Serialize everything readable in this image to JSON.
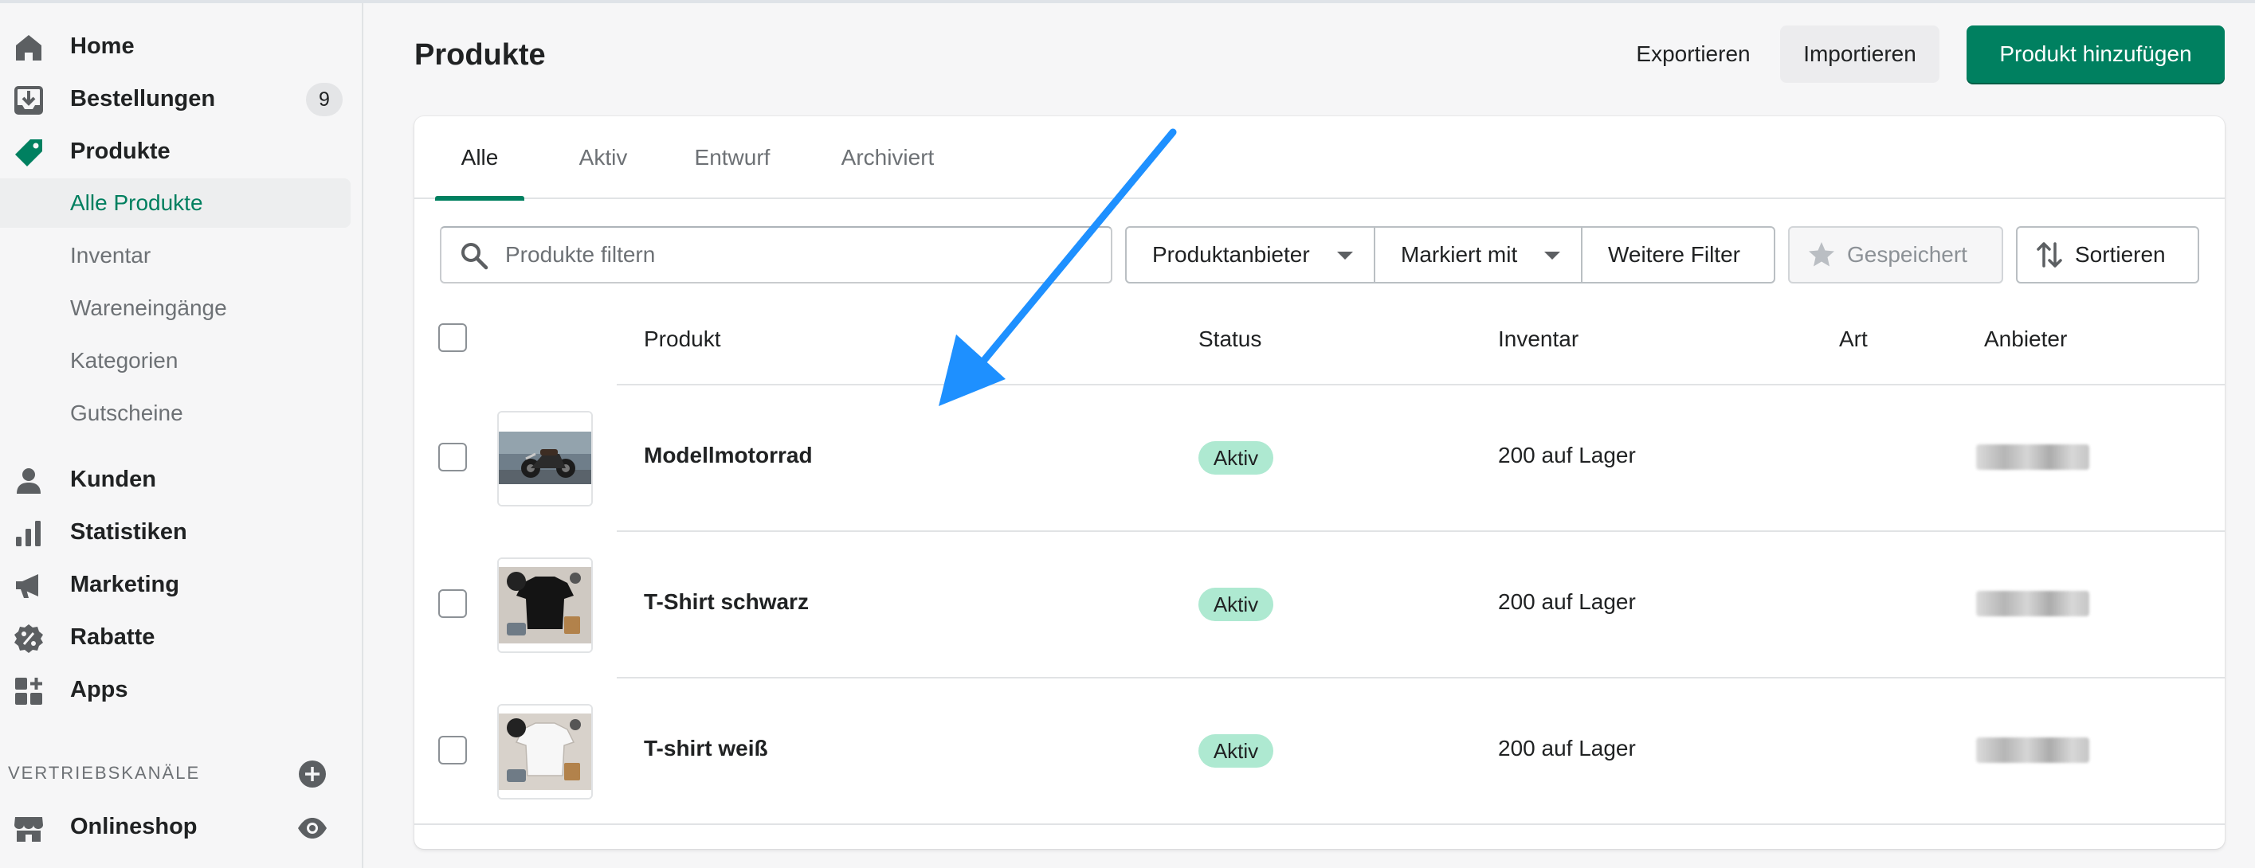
{
  "sidebar": {
    "items": [
      {
        "label": "Home",
        "icon": "home-icon"
      },
      {
        "label": "Bestellungen",
        "icon": "orders-icon",
        "badge": "9"
      },
      {
        "label": "Produkte",
        "icon": "tag-icon"
      },
      {
        "label": "Kunden",
        "icon": "person-icon"
      },
      {
        "label": "Statistiken",
        "icon": "bar-chart-icon"
      },
      {
        "label": "Marketing",
        "icon": "megaphone-icon"
      },
      {
        "label": "Rabatte",
        "icon": "discount-icon"
      },
      {
        "label": "Apps",
        "icon": "apps-icon"
      }
    ],
    "subitems": [
      "Alle Produkte",
      "Inventar",
      "Wareneingänge",
      "Kategorien",
      "Gutscheine"
    ],
    "section_title": "VERTRIEBSKANÄLE",
    "channel": {
      "label": "Onlineshop",
      "icon": "store-icon"
    }
  },
  "header": {
    "title": "Produkte",
    "export_label": "Exportieren",
    "import_label": "Importieren",
    "add_label": "Produkt hinzufügen"
  },
  "tabs": [
    "Alle",
    "Aktiv",
    "Entwurf",
    "Archiviert"
  ],
  "filters": {
    "search_placeholder": "Produkte filtern",
    "vendor_label": "Produktanbieter",
    "tagged_label": "Markiert mit",
    "more_label": "Weitere Filter",
    "saved_label": "Gespeichert",
    "sort_label": "Sortieren"
  },
  "table": {
    "columns": [
      "Produkt",
      "Status",
      "Inventar",
      "Art",
      "Anbieter"
    ],
    "rows": [
      {
        "name": "Modellmotorrad",
        "status": "Aktiv",
        "inventory": "200 auf Lager"
      },
      {
        "name": "T-Shirt schwarz",
        "status": "Aktiv",
        "inventory": "200 auf Lager"
      },
      {
        "name": "T-shirt weiß",
        "status": "Aktiv",
        "inventory": "200 auf Lager"
      }
    ]
  },
  "colors": {
    "accent": "#008060",
    "active_badge": "#aee9d1",
    "arrow": "#1e90ff"
  }
}
